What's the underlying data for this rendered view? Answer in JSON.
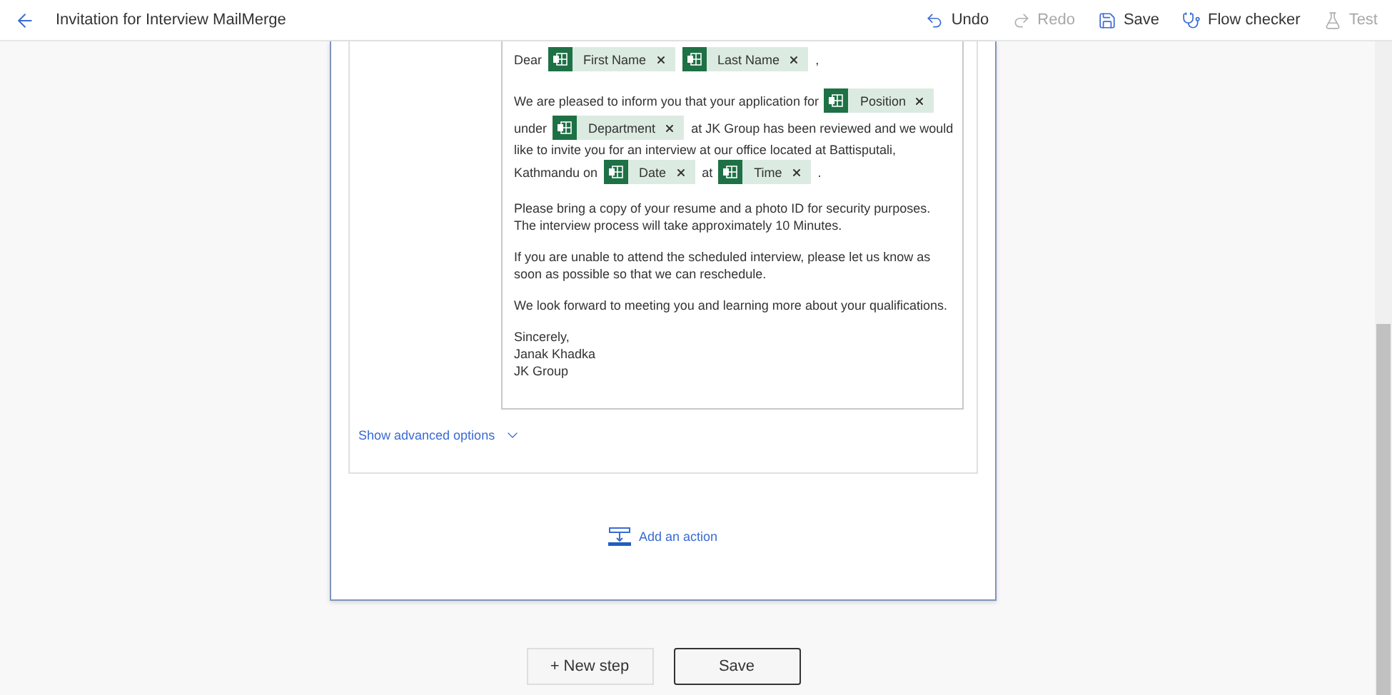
{
  "header": {
    "title": "Invitation for Interview MailMerge",
    "actions": [
      {
        "kind": "undo",
        "label": "Undo",
        "disabled": false
      },
      {
        "kind": "redo",
        "label": "Redo",
        "disabled": true
      },
      {
        "kind": "save",
        "label": "Save",
        "disabled": false
      },
      {
        "kind": "checker",
        "label": "Flow checker",
        "disabled": false
      },
      {
        "kind": "test",
        "label": "Test",
        "disabled": true
      }
    ]
  },
  "email_body": {
    "paragraphs": [
      {
        "lines": [
          [
            {
              "kind": "text",
              "text": "Dear"
            },
            {
              "kind": "token",
              "text": "First Name"
            },
            {
              "kind": "token",
              "text": "Last Name"
            },
            {
              "kind": "text",
              "text": ","
            }
          ]
        ]
      },
      {
        "lines": [
          [
            {
              "kind": "text",
              "text": "We are pleased to inform you that your application for"
            },
            {
              "kind": "token",
              "text": "Position"
            }
          ],
          [
            {
              "kind": "text",
              "text": "under"
            },
            {
              "kind": "token",
              "text": "Department"
            },
            {
              "kind": "text",
              "text": "at JK Group has been reviewed and we would"
            }
          ],
          [
            {
              "kind": "text",
              "text": "like to invite you for an interview at our office located at Battisputali,"
            }
          ],
          [
            {
              "kind": "text",
              "text": "Kathmandu on"
            },
            {
              "kind": "token",
              "text": "Date"
            },
            {
              "kind": "text",
              "text": "at"
            },
            {
              "kind": "token",
              "text": "Time"
            },
            {
              "kind": "text",
              "text": "."
            }
          ]
        ]
      },
      {
        "text": "Please bring a copy of your resume and a photo ID for security purposes. The interview process will take approximately 10 Minutes."
      },
      {
        "text": "If you are unable to attend the scheduled interview, please let us know as soon as possible so that we can reschedule."
      },
      {
        "text": "We look forward to meeting you and learning more about your qualifications."
      }
    ],
    "signature": [
      "Sincerely,",
      "Janak Khadka",
      "JK Group"
    ]
  },
  "advanced_options": {
    "label": "Show advanced options",
    "expanded": false
  },
  "add_action": {
    "label": "Add an action"
  },
  "footer_buttons": [
    {
      "kind": "secondary",
      "label": "+ New step"
    },
    {
      "kind": "primary",
      "label": "Save"
    }
  ]
}
